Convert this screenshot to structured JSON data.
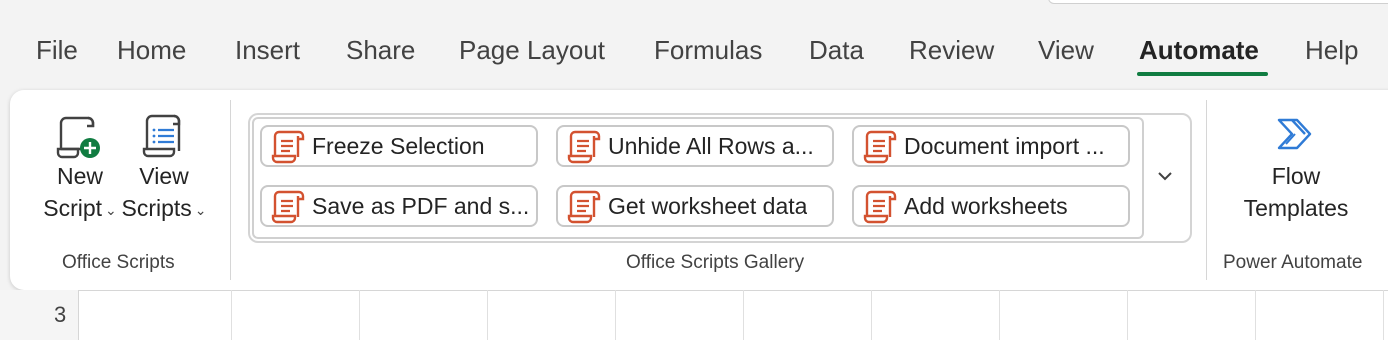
{
  "tabs": [
    {
      "label": "File",
      "active": false
    },
    {
      "label": "Home",
      "active": false
    },
    {
      "label": "Insert",
      "active": false
    },
    {
      "label": "Share",
      "active": false
    },
    {
      "label": "Page Layout",
      "active": false
    },
    {
      "label": "Formulas",
      "active": false
    },
    {
      "label": "Data",
      "active": false
    },
    {
      "label": "Review",
      "active": false
    },
    {
      "label": "View",
      "active": false
    },
    {
      "label": "Automate",
      "active": true
    },
    {
      "label": "Help",
      "active": false
    }
  ],
  "ribbon": {
    "office_scripts": {
      "new_script": {
        "line1": "New",
        "line2": "Script"
      },
      "view_scripts": {
        "line1": "View",
        "line2": "Scripts"
      },
      "group_label": "Office Scripts"
    },
    "gallery": {
      "items": [
        "Freeze Selection",
        "Unhide All Rows a...",
        "Document import ...",
        "Save as PDF and s...",
        "Get worksheet data",
        "Add worksheets"
      ],
      "group_label": "Office Scripts Gallery",
      "more_icon": "chevron-down-icon"
    },
    "power_automate": {
      "flow_templates": {
        "line1": "Flow",
        "line2": "Templates"
      },
      "group_label": "Power Automate"
    }
  },
  "sheet": {
    "row_number": "3"
  },
  "colors": {
    "accent_green": "#107c41",
    "script_orange": "#d35230",
    "flow_blue": "#2f7bd6"
  }
}
